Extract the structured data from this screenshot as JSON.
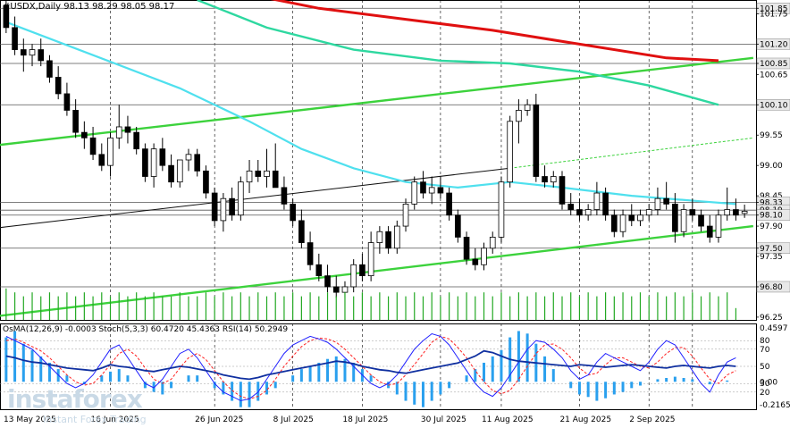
{
  "header": {
    "symbol": "#USDX,Daily",
    "ohlc": "98.13 98.29 98.05 98.17"
  },
  "oscillator_header": "OsMA(12,26,9) -0.0003  Stoch(5,3,3) 60.4720 45.4363  RSI(14) 50.2949",
  "watermark": {
    "brand": "instaforex",
    "tagline": "Instant Forex Trading"
  },
  "colors": {
    "bull_body": "#ffffff",
    "bear_body": "#000000",
    "ma_red": "#e01010",
    "ma_green": "#2ed8a0",
    "ma_cyan": "#4fe0ee",
    "trend_green": "#3cd23c",
    "volume": "#22a822",
    "osma": "#2aa0ee",
    "rsi": "#1030a0",
    "stoch_main": "#2020ff",
    "stoch_signal": "#ff2020"
  },
  "chart_data": {
    "type": "candlestick",
    "symbol": "#USDX",
    "timeframe": "Daily",
    "price_axis_labels": [
      "101.85",
      "101.75",
      "101.20",
      "100.85",
      "100.65",
      "100.10",
      "99.55",
      "99.00",
      "98.45",
      "98.33",
      "98.19",
      "98.10",
      "97.90",
      "97.50",
      "97.35",
      "96.80",
      "96.25"
    ],
    "highlighted_levels": [
      "101.85",
      "101.20",
      "100.85",
      "100.10",
      "98.33",
      "98.19",
      "98.10",
      "97.50",
      "96.80"
    ],
    "ylim": [
      96.2,
      102.0
    ],
    "date_labels": [
      "13 May 2025",
      "16 Jun 2025",
      "26 Jun 2025",
      "8 Jul 2025",
      "18 Jul 2025",
      "30 Jul 2025",
      "11 Aug 2025",
      "21 Aug 2025",
      "2 Sep 2025"
    ],
    "ohlc": [
      [
        101.9,
        102.0,
        101.4,
        101.5
      ],
      [
        101.5,
        101.7,
        101.0,
        101.1
      ],
      [
        101.1,
        101.3,
        100.7,
        101.0
      ],
      [
        101.0,
        101.2,
        100.8,
        101.1
      ],
      [
        101.1,
        101.3,
        100.8,
        100.9
      ],
      [
        100.9,
        101.0,
        100.5,
        100.6
      ],
      [
        100.6,
        100.8,
        100.2,
        100.3
      ],
      [
        100.3,
        100.5,
        99.9,
        100.0
      ],
      [
        100.0,
        100.2,
        99.5,
        99.6
      ],
      [
        99.6,
        99.8,
        99.3,
        99.5
      ],
      [
        99.5,
        99.7,
        99.1,
        99.2
      ],
      [
        99.2,
        99.4,
        98.9,
        99.0
      ],
      [
        99.0,
        99.6,
        98.8,
        99.5
      ],
      [
        99.5,
        100.1,
        99.3,
        99.7
      ],
      [
        99.7,
        99.9,
        99.4,
        99.6
      ],
      [
        99.6,
        99.7,
        99.2,
        99.3
      ],
      [
        99.3,
        99.4,
        98.7,
        98.8
      ],
      [
        98.8,
        99.4,
        98.6,
        99.3
      ],
      [
        99.3,
        99.5,
        98.9,
        99.0
      ],
      [
        99.0,
        99.2,
        98.6,
        98.7
      ],
      [
        98.7,
        99.1,
        98.6,
        99.1
      ],
      [
        99.1,
        99.3,
        98.9,
        99.2
      ],
      [
        99.2,
        99.3,
        98.8,
        98.9
      ],
      [
        98.9,
        99.0,
        98.4,
        98.5
      ],
      [
        98.5,
        98.6,
        97.9,
        98.0
      ],
      [
        98.0,
        98.5,
        97.8,
        98.4
      ],
      [
        98.4,
        98.6,
        98.0,
        98.1
      ],
      [
        98.1,
        98.8,
        98.0,
        98.7
      ],
      [
        98.7,
        99.1,
        98.5,
        98.9
      ],
      [
        98.9,
        99.1,
        98.7,
        98.8
      ],
      [
        98.8,
        99.3,
        98.6,
        98.9
      ],
      [
        98.9,
        99.4,
        98.7,
        98.6
      ],
      [
        98.6,
        98.8,
        98.2,
        98.3
      ],
      [
        98.3,
        98.4,
        97.9,
        98.0
      ],
      [
        98.0,
        98.2,
        97.5,
        97.6
      ],
      [
        97.6,
        97.8,
        97.1,
        97.2
      ],
      [
        97.2,
        97.4,
        96.9,
        97.0
      ],
      [
        97.0,
        97.2,
        96.7,
        96.8
      ],
      [
        96.8,
        97.0,
        96.6,
        96.7
      ],
      [
        96.7,
        96.9,
        96.6,
        96.8
      ],
      [
        96.8,
        97.3,
        96.7,
        97.2
      ],
      [
        97.2,
        97.4,
        96.9,
        97.0
      ],
      [
        97.0,
        97.8,
        96.9,
        97.6
      ],
      [
        97.6,
        97.9,
        97.4,
        97.8
      ],
      [
        97.8,
        97.9,
        97.4,
        97.5
      ],
      [
        97.5,
        98.0,
        97.4,
        97.9
      ],
      [
        97.9,
        98.4,
        97.8,
        98.3
      ],
      [
        98.3,
        98.8,
        98.2,
        98.7
      ],
      [
        98.7,
        98.9,
        98.4,
        98.5
      ],
      [
        98.5,
        98.8,
        98.3,
        98.6
      ],
      [
        98.6,
        98.8,
        98.4,
        98.5
      ],
      [
        98.5,
        98.6,
        98.0,
        98.1
      ],
      [
        98.1,
        98.2,
        97.6,
        97.7
      ],
      [
        97.7,
        97.8,
        97.2,
        97.3
      ],
      [
        97.3,
        97.5,
        97.1,
        97.2
      ],
      [
        97.2,
        97.6,
        97.1,
        97.5
      ],
      [
        97.5,
        97.8,
        97.4,
        97.7
      ],
      [
        97.7,
        98.8,
        97.6,
        98.7
      ],
      [
        98.7,
        99.9,
        98.6,
        99.8
      ],
      [
        99.8,
        100.2,
        99.4,
        100.0
      ],
      [
        100.0,
        100.2,
        99.9,
        100.1
      ],
      [
        100.1,
        100.3,
        98.7,
        98.8
      ],
      [
        98.8,
        99.0,
        98.6,
        98.7
      ],
      [
        98.7,
        98.9,
        98.6,
        98.8
      ],
      [
        98.8,
        98.9,
        98.2,
        98.3
      ],
      [
        98.3,
        98.5,
        98.1,
        98.2
      ],
      [
        98.2,
        98.4,
        98.0,
        98.1
      ],
      [
        98.1,
        98.3,
        98.0,
        98.2
      ],
      [
        98.2,
        98.7,
        98.1,
        98.5
      ],
      [
        98.5,
        98.6,
        98.0,
        98.1
      ],
      [
        98.1,
        98.2,
        97.7,
        97.8
      ],
      [
        97.8,
        98.2,
        97.7,
        98.1
      ],
      [
        98.1,
        98.3,
        97.9,
        98.0
      ],
      [
        98.0,
        98.2,
        97.9,
        98.1
      ],
      [
        98.1,
        98.3,
        98.0,
        98.2
      ],
      [
        98.2,
        98.6,
        98.1,
        98.4
      ],
      [
        98.4,
        98.7,
        98.2,
        98.3
      ],
      [
        98.3,
        98.5,
        97.6,
        97.8
      ],
      [
        97.8,
        98.3,
        97.7,
        98.2
      ],
      [
        98.2,
        98.4,
        98.0,
        98.1
      ],
      [
        98.1,
        98.2,
        97.8,
        97.9
      ],
      [
        97.9,
        98.1,
        97.6,
        97.7
      ],
      [
        97.7,
        98.2,
        97.6,
        98.1
      ],
      [
        98.1,
        98.6,
        98.0,
        98.2
      ],
      [
        98.2,
        98.4,
        98.0,
        98.1
      ],
      [
        98.13,
        98.29,
        98.05,
        98.17
      ]
    ],
    "volume": [
      0.8,
      0.7,
      0.6,
      0.7,
      0.6,
      0.7,
      0.6,
      0.7,
      0.6,
      0.7,
      0.6,
      0.7,
      0.6,
      0.7,
      0.6,
      0.7,
      0.6,
      0.7,
      0.6,
      0.6,
      0.7,
      0.6,
      0.6,
      0.7,
      0.6,
      0.7,
      0.6,
      0.7,
      0.6,
      0.7,
      0.6,
      0.7,
      0.6,
      0.7,
      0.6,
      0.7,
      0.6,
      0.7,
      0.6,
      0.7,
      0.6,
      0.7,
      0.6,
      0.7,
      0.6,
      0.7,
      0.6,
      0.7,
      0.6,
      0.7,
      0.6,
      0.7,
      0.6,
      0.7,
      0.6,
      0.7,
      0.6,
      0.7,
      0.6,
      0.7,
      0.6,
      0.7,
      0.6,
      0.7,
      0.6,
      0.7,
      0.6,
      0.7,
      0.6,
      0.7,
      0.6,
      0.7,
      0.6,
      0.7,
      0.6,
      0.7,
      0.6,
      0.7,
      0.6,
      0.7,
      0.6,
      0.7,
      0.6,
      0.7,
      0.3
    ],
    "oscillator": {
      "axis_labels": [
        "0.4597",
        "80",
        "70",
        "50",
        "30",
        "20",
        "0.00",
        "-0.2165"
      ],
      "osma": [
        0.35,
        0.4,
        0.3,
        0.25,
        0.2,
        0.15,
        0.1,
        0.05,
        0.0,
        -0.02,
        0.0,
        0.05,
        0.08,
        0.1,
        0.05,
        0.0,
        -0.05,
        -0.08,
        -0.1,
        -0.05,
        0.0,
        0.05,
        0.05,
        0.0,
        -0.05,
        -0.1,
        -0.15,
        -0.2,
        -0.2,
        -0.15,
        -0.1,
        -0.05,
        0.0,
        0.05,
        0.1,
        0.12,
        0.15,
        0.18,
        0.2,
        0.18,
        0.15,
        0.1,
        0.05,
        0.0,
        -0.05,
        -0.1,
        -0.15,
        -0.18,
        -0.2,
        -0.15,
        -0.1,
        -0.05,
        0.0,
        0.05,
        0.1,
        0.15,
        0.2,
        0.25,
        0.35,
        0.4,
        0.38,
        0.3,
        0.2,
        0.1,
        0.0,
        -0.05,
        -0.1,
        -0.12,
        -0.15,
        -0.13,
        -0.1,
        -0.08,
        -0.05,
        -0.03,
        0.0,
        0.02,
        0.03,
        0.04,
        0.03,
        0.02,
        0.0,
        -0.02,
        0.0,
        0.01,
        0.0
      ],
      "rsi": [
        62,
        60,
        57,
        55,
        54,
        52,
        50,
        48,
        47,
        46,
        45,
        48,
        52,
        50,
        49,
        47,
        45,
        44,
        46,
        48,
        50,
        49,
        47,
        45,
        43,
        40,
        38,
        36,
        35,
        37,
        40,
        42,
        44,
        46,
        48,
        50,
        52,
        54,
        56,
        55,
        53,
        50,
        48,
        46,
        45,
        43,
        42,
        44,
        46,
        48,
        50,
        52,
        54,
        58,
        62,
        68,
        66,
        62,
        58,
        56,
        55,
        54,
        53,
        52,
        51,
        50,
        52,
        51,
        50,
        49,
        50,
        51,
        52,
        51,
        50,
        49,
        48,
        50,
        51,
        50,
        49,
        48,
        50,
        51,
        50
      ],
      "stoch_main": [
        85,
        80,
        75,
        70,
        60,
        50,
        40,
        30,
        25,
        30,
        40,
        55,
        70,
        75,
        60,
        45,
        30,
        25,
        35,
        50,
        65,
        70,
        60,
        45,
        30,
        20,
        15,
        10,
        12,
        20,
        35,
        50,
        65,
        75,
        80,
        85,
        82,
        78,
        70,
        60,
        50,
        40,
        30,
        25,
        30,
        40,
        55,
        70,
        80,
        88,
        85,
        75,
        60,
        45,
        30,
        20,
        15,
        25,
        40,
        55,
        70,
        80,
        78,
        70,
        60,
        45,
        35,
        40,
        55,
        65,
        60,
        55,
        50,
        45,
        55,
        70,
        80,
        75,
        60,
        45,
        30,
        20,
        40,
        55,
        60
      ],
      "stoch_signal": [
        80,
        82,
        78,
        73,
        68,
        60,
        50,
        40,
        32,
        28,
        30,
        40,
        52,
        65,
        70,
        62,
        48,
        35,
        30,
        35,
        48,
        60,
        65,
        58,
        45,
        32,
        22,
        15,
        12,
        15,
        22,
        35,
        50,
        62,
        73,
        80,
        83,
        82,
        78,
        70,
        60,
        50,
        40,
        32,
        28,
        30,
        40,
        52,
        65,
        78,
        85,
        82,
        72,
        60,
        45,
        32,
        22,
        18,
        22,
        35,
        50,
        65,
        75,
        76,
        70,
        60,
        48,
        40,
        42,
        52,
        60,
        60,
        55,
        50,
        48,
        55,
        65,
        72,
        72,
        62,
        48,
        35,
        30,
        40,
        45
      ]
    }
  }
}
